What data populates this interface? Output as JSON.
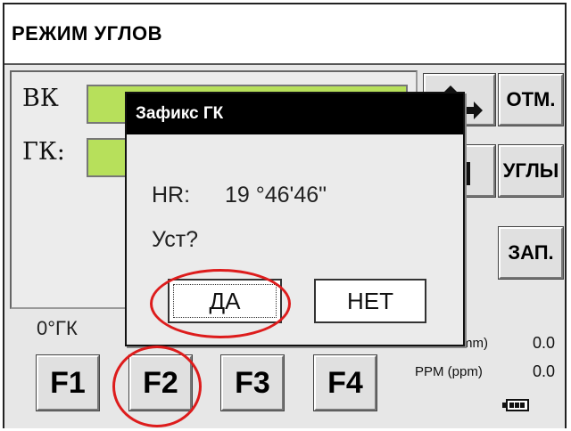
{
  "header": {
    "title": "РЕЖИМ УГЛОВ"
  },
  "measurements": {
    "vk_label": "ВК",
    "gk_label": "ГК:"
  },
  "side_keys": {
    "switch_icon": "arrow-switch-icon",
    "otm_label": "ОТМ.",
    "level_icon": "level-icon",
    "ugly_label": "УГЛЫ",
    "zap_label": "ЗАП."
  },
  "softkeys": {
    "zero_hr_label": "0°ГК",
    "f1": "F1",
    "f2": "F2",
    "f3": "F3",
    "f4": "F4"
  },
  "status": {
    "prism_unit": "mm)",
    "prism_value": "0.0",
    "ppm_label": "PPM (ppm)",
    "ppm_value": "0.0",
    "battery_icon": "battery-icon",
    "battery_level": 1.0
  },
  "dialog": {
    "title": "Зафикс ГК",
    "hr_label": "HR:",
    "hr_value": "19 °46'46\"",
    "question": "Уст?",
    "yes_label": "ДА",
    "no_label": "НЕТ"
  },
  "annotation_color": "#dd1c1c"
}
